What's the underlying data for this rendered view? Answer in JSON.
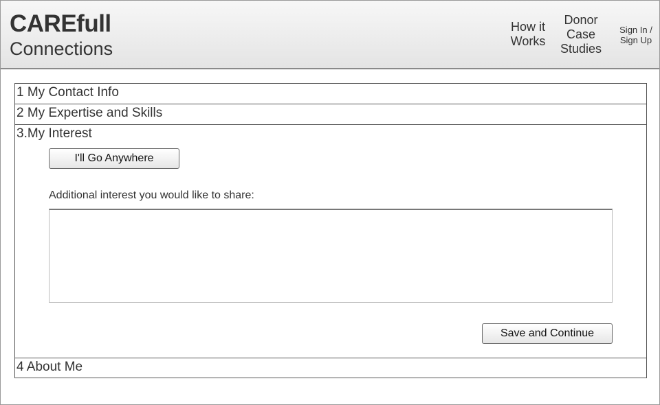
{
  "header": {
    "logo_line1": "CAREfull",
    "logo_line2": "Connections",
    "nav": {
      "how_it_works": [
        "How it",
        "Works"
      ],
      "donor_case_studies": [
        "Donor",
        "Case",
        "Studies"
      ],
      "sign_in": [
        "Sign In /",
        "Sign Up"
      ]
    }
  },
  "sections": {
    "contact": "1 My Contact Info",
    "expertise": "2 My Expertise and Skills",
    "interest": "3.My Interest",
    "about": "4 About Me"
  },
  "interest": {
    "anywhere_button": "I'll Go Anywhere",
    "share_label": "Additional interest you would like to share:",
    "share_value": "",
    "save_button": "Save and Continue"
  }
}
